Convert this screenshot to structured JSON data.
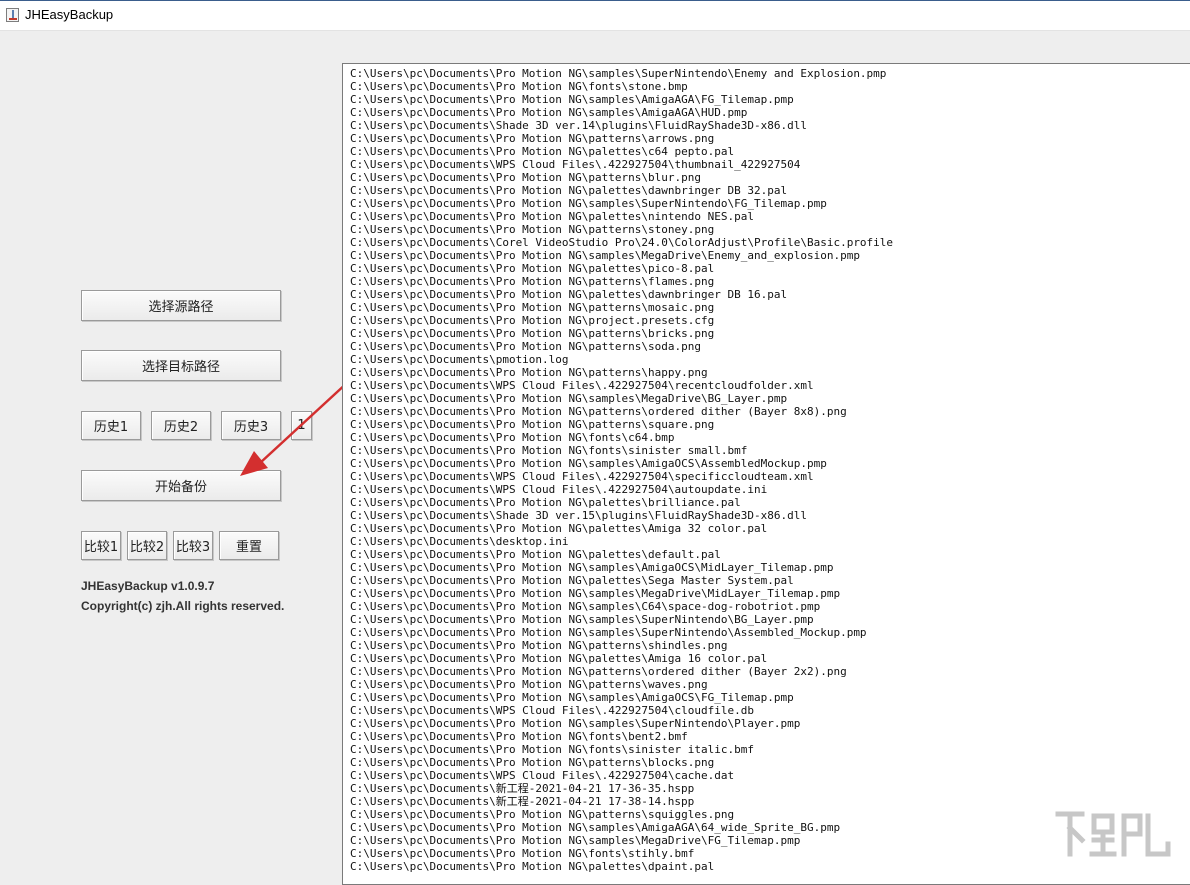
{
  "window": {
    "title": "JHEasyBackup",
    "icon": "java-cup-icon"
  },
  "buttons": {
    "select_source": "选择源路径",
    "select_target": "选择目标路径",
    "history1": "历史1",
    "history2": "历史2",
    "history3": "历史3",
    "extra": "1",
    "start_backup": "开始备份",
    "compare1": "比较1",
    "compare2": "比较2",
    "compare3": "比较3",
    "reset": "重置"
  },
  "info": {
    "version": "JHEasyBackup v1.0.9.7",
    "copyright": "Copyright(c) zjh.All rights reserved."
  },
  "annotation": {
    "arrow_color": "#d32f2f",
    "icon": "red-arrow-icon"
  },
  "file_list": [
    "C:\\Users\\pc\\Documents\\Pro Motion NG\\samples\\SuperNintendo\\Enemy and Explosion.pmp",
    "C:\\Users\\pc\\Documents\\Pro Motion NG\\fonts\\stone.bmp",
    "C:\\Users\\pc\\Documents\\Pro Motion NG\\samples\\AmigaAGA\\FG_Tilemap.pmp",
    "C:\\Users\\pc\\Documents\\Pro Motion NG\\samples\\AmigaAGA\\HUD.pmp",
    "C:\\Users\\pc\\Documents\\Shade 3D ver.14\\plugins\\FluidRayShade3D-x86.dll",
    "C:\\Users\\pc\\Documents\\Pro Motion NG\\patterns\\arrows.png",
    "C:\\Users\\pc\\Documents\\Pro Motion NG\\palettes\\c64 pepto.pal",
    "C:\\Users\\pc\\Documents\\WPS Cloud Files\\.422927504\\thumbnail_422927504",
    "C:\\Users\\pc\\Documents\\Pro Motion NG\\patterns\\blur.png",
    "C:\\Users\\pc\\Documents\\Pro Motion NG\\palettes\\dawnbringer DB 32.pal",
    "C:\\Users\\pc\\Documents\\Pro Motion NG\\samples\\SuperNintendo\\FG_Tilemap.pmp",
    "C:\\Users\\pc\\Documents\\Pro Motion NG\\palettes\\nintendo NES.pal",
    "C:\\Users\\pc\\Documents\\Pro Motion NG\\patterns\\stoney.png",
    "C:\\Users\\pc\\Documents\\Corel VideoStudio Pro\\24.0\\ColorAdjust\\Profile\\Basic.profile",
    "C:\\Users\\pc\\Documents\\Pro Motion NG\\samples\\MegaDrive\\Enemy_and_explosion.pmp",
    "C:\\Users\\pc\\Documents\\Pro Motion NG\\palettes\\pico-8.pal",
    "C:\\Users\\pc\\Documents\\Pro Motion NG\\patterns\\flames.png",
    "C:\\Users\\pc\\Documents\\Pro Motion NG\\palettes\\dawnbringer DB 16.pal",
    "C:\\Users\\pc\\Documents\\Pro Motion NG\\patterns\\mosaic.png",
    "C:\\Users\\pc\\Documents\\Pro Motion NG\\project.presets.cfg",
    "C:\\Users\\pc\\Documents\\Pro Motion NG\\patterns\\bricks.png",
    "C:\\Users\\pc\\Documents\\Pro Motion NG\\patterns\\soda.png",
    "C:\\Users\\pc\\Documents\\pmotion.log",
    "C:\\Users\\pc\\Documents\\Pro Motion NG\\patterns\\happy.png",
    "C:\\Users\\pc\\Documents\\WPS Cloud Files\\.422927504\\recentcloudfolder.xml",
    "C:\\Users\\pc\\Documents\\Pro Motion NG\\samples\\MegaDrive\\BG_Layer.pmp",
    "C:\\Users\\pc\\Documents\\Pro Motion NG\\patterns\\ordered dither (Bayer 8x8).png",
    "C:\\Users\\pc\\Documents\\Pro Motion NG\\patterns\\square.png",
    "C:\\Users\\pc\\Documents\\Pro Motion NG\\fonts\\c64.bmp",
    "C:\\Users\\pc\\Documents\\Pro Motion NG\\fonts\\sinister small.bmf",
    "C:\\Users\\pc\\Documents\\Pro Motion NG\\samples\\AmigaOCS\\AssembledMockup.pmp",
    "C:\\Users\\pc\\Documents\\WPS Cloud Files\\.422927504\\specificcloudteam.xml",
    "C:\\Users\\pc\\Documents\\WPS Cloud Files\\.422927504\\autoupdate.ini",
    "C:\\Users\\pc\\Documents\\Pro Motion NG\\palettes\\brilliance.pal",
    "C:\\Users\\pc\\Documents\\Shade 3D ver.15\\plugins\\FluidRayShade3D-x86.dll",
    "C:\\Users\\pc\\Documents\\Pro Motion NG\\palettes\\Amiga 32 color.pal",
    "C:\\Users\\pc\\Documents\\desktop.ini",
    "C:\\Users\\pc\\Documents\\Pro Motion NG\\palettes\\default.pal",
    "C:\\Users\\pc\\Documents\\Pro Motion NG\\samples\\AmigaOCS\\MidLayer_Tilemap.pmp",
    "C:\\Users\\pc\\Documents\\Pro Motion NG\\palettes\\Sega Master System.pal",
    "C:\\Users\\pc\\Documents\\Pro Motion NG\\samples\\MegaDrive\\MidLayer_Tilemap.pmp",
    "C:\\Users\\pc\\Documents\\Pro Motion NG\\samples\\C64\\space-dog-robotriot.pmp",
    "C:\\Users\\pc\\Documents\\Pro Motion NG\\samples\\SuperNintendo\\BG_Layer.pmp",
    "C:\\Users\\pc\\Documents\\Pro Motion NG\\samples\\SuperNintendo\\Assembled_Mockup.pmp",
    "C:\\Users\\pc\\Documents\\Pro Motion NG\\patterns\\shindles.png",
    "C:\\Users\\pc\\Documents\\Pro Motion NG\\palettes\\Amiga 16 color.pal",
    "C:\\Users\\pc\\Documents\\Pro Motion NG\\patterns\\ordered dither (Bayer 2x2).png",
    "C:\\Users\\pc\\Documents\\Pro Motion NG\\patterns\\waves.png",
    "C:\\Users\\pc\\Documents\\Pro Motion NG\\samples\\AmigaOCS\\FG_Tilemap.pmp",
    "C:\\Users\\pc\\Documents\\WPS Cloud Files\\.422927504\\cloudfile.db",
    "C:\\Users\\pc\\Documents\\Pro Motion NG\\samples\\SuperNintendo\\Player.pmp",
    "C:\\Users\\pc\\Documents\\Pro Motion NG\\fonts\\bent2.bmf",
    "C:\\Users\\pc\\Documents\\Pro Motion NG\\fonts\\sinister italic.bmf",
    "C:\\Users\\pc\\Documents\\Pro Motion NG\\patterns\\blocks.png",
    "C:\\Users\\pc\\Documents\\WPS Cloud Files\\.422927504\\cache.dat",
    "C:\\Users\\pc\\Documents\\新工程-2021-04-21 17-36-35.hspp",
    "C:\\Users\\pc\\Documents\\新工程-2021-04-21 17-38-14.hspp",
    "C:\\Users\\pc\\Documents\\Pro Motion NG\\patterns\\squiggles.png",
    "C:\\Users\\pc\\Documents\\Pro Motion NG\\samples\\AmigaAGA\\64_wide_Sprite_BG.pmp",
    "C:\\Users\\pc\\Documents\\Pro Motion NG\\samples\\MegaDrive\\FG_Tilemap.pmp",
    "C:\\Users\\pc\\Documents\\Pro Motion NG\\fonts\\stihly.bmf",
    "C:\\Users\\pc\\Documents\\Pro Motion NG\\palettes\\dpaint.pal"
  ]
}
